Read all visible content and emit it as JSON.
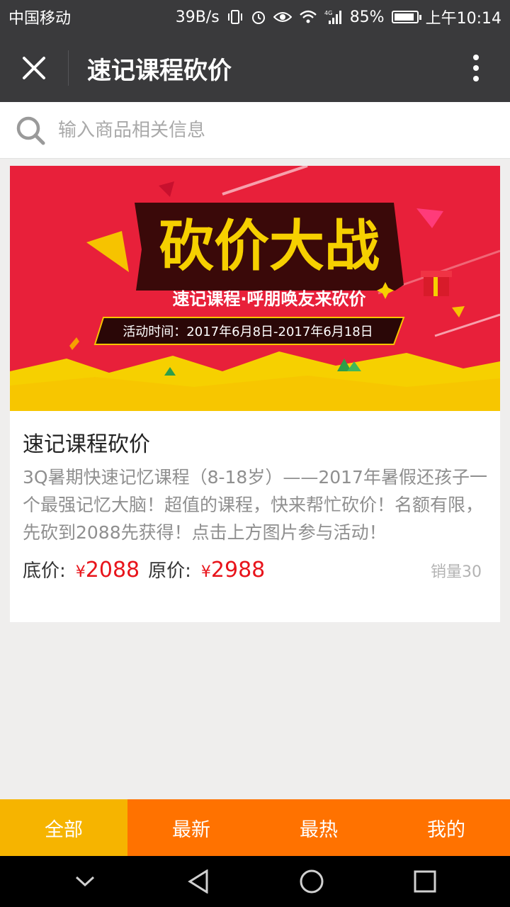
{
  "status_bar": {
    "carrier": "中国移动",
    "net_speed": "39B/s",
    "signal_type": "4G",
    "battery": "85%",
    "battery_level": 0.85,
    "time": "上午10:14"
  },
  "title_bar": {
    "title": "速记课程砍价",
    "close_icon": "close-icon",
    "more_icon": "more-vertical-icon"
  },
  "search": {
    "placeholder": "输入商品相关信息",
    "value": ""
  },
  "product": {
    "banner": {
      "headline": "砍价大战",
      "subline": "速记课程·呼朋唤友来砍价",
      "dates": "活动时间：2017年6月8日-2017年6月18日",
      "bg_color": "#e8203a",
      "accent_color": "#f6d000"
    },
    "title": "速记课程砍价",
    "description": "3Q暑期快速记忆课程（8-18岁）——2017年暑假还孩子一个最强记忆大脑！超值的课程，快来帮忙砍价！名额有限，先砍到2088先获得！点击上方图片参与活动！",
    "floor_price_label": "底价:",
    "floor_price_symbol": "¥",
    "floor_price": "2088",
    "original_price_label": "原价:",
    "original_price_symbol": "¥",
    "original_price": "2988",
    "sales": "销量30"
  },
  "tabs": [
    {
      "label": "全部",
      "active": true
    },
    {
      "label": "最新",
      "active": false
    },
    {
      "label": "最热",
      "active": false
    },
    {
      "label": "我的",
      "active": false
    }
  ],
  "colors": {
    "header_bg": "#3a3a3c",
    "tab_active": "#f6b400",
    "tab_normal": "#ff7200",
    "price": "#e8141b"
  },
  "nav_icons": [
    "chevron-down-icon",
    "back-icon",
    "home-icon",
    "recents-icon"
  ]
}
